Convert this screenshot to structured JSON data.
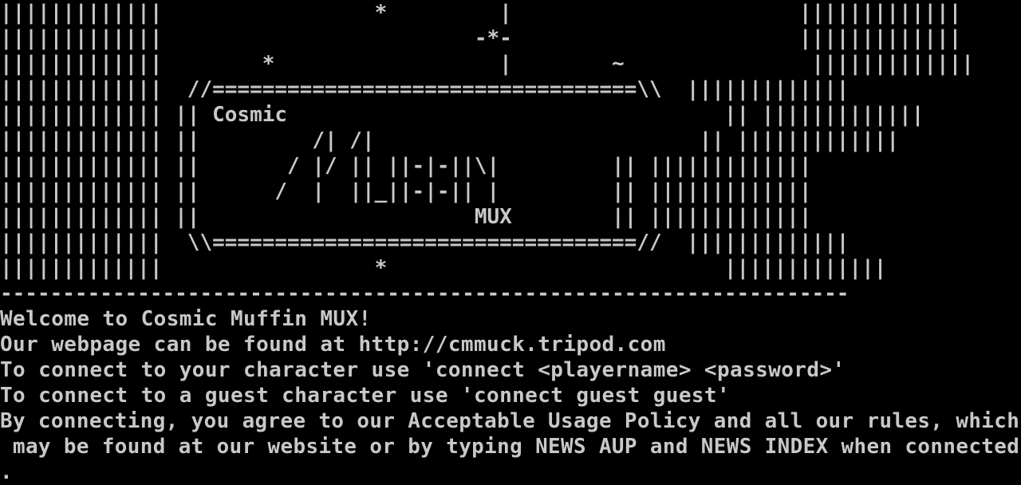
{
  "terminal": {
    "background": "#000000",
    "foreground": "#c8c8c8",
    "banner": [
      "|||||||||||||                 *         |                       |||||||||||||",
      "|||||||||||||                         -*-                       |||||||||||||",
      "|||||||||||||        *                  |        ~               |||||||||||||",
      "|||||||||||||  //==================================\\\\  |||||||||||||",
      "||||||||||||| || Cosmic                                   || |||||||||||||",
      "||||||||||||| ||         /| /|                          || |||||||||||||",
      "||||||||||||| ||       / |/ || ||-|-||\\|         || |||||||||||||",
      "||||||||||||| ||      /  |  ||_||-|-|| |         || |||||||||||||",
      "||||||||||||| ||                      MUX        || |||||||||||||",
      "|||||||||||||  \\\\==================================//  |||||||||||||",
      "|||||||||||||                 *                           |||||||||||||",
      "--------------------------------------------------------------------"
    ],
    "messages": [
      "Welcome to Cosmic Muffin MUX!",
      "Our webpage can be found at http://cmmuck.tripod.com",
      "To connect to your character use 'connect <playername> <password>'",
      "To connect to a guest character use 'connect guest guest'",
      "By connecting, you agree to our Acceptable Usage Policy and all our rules, which",
      " may be found at our website or by typing NEWS AUP and NEWS INDEX when connected",
      "."
    ]
  }
}
